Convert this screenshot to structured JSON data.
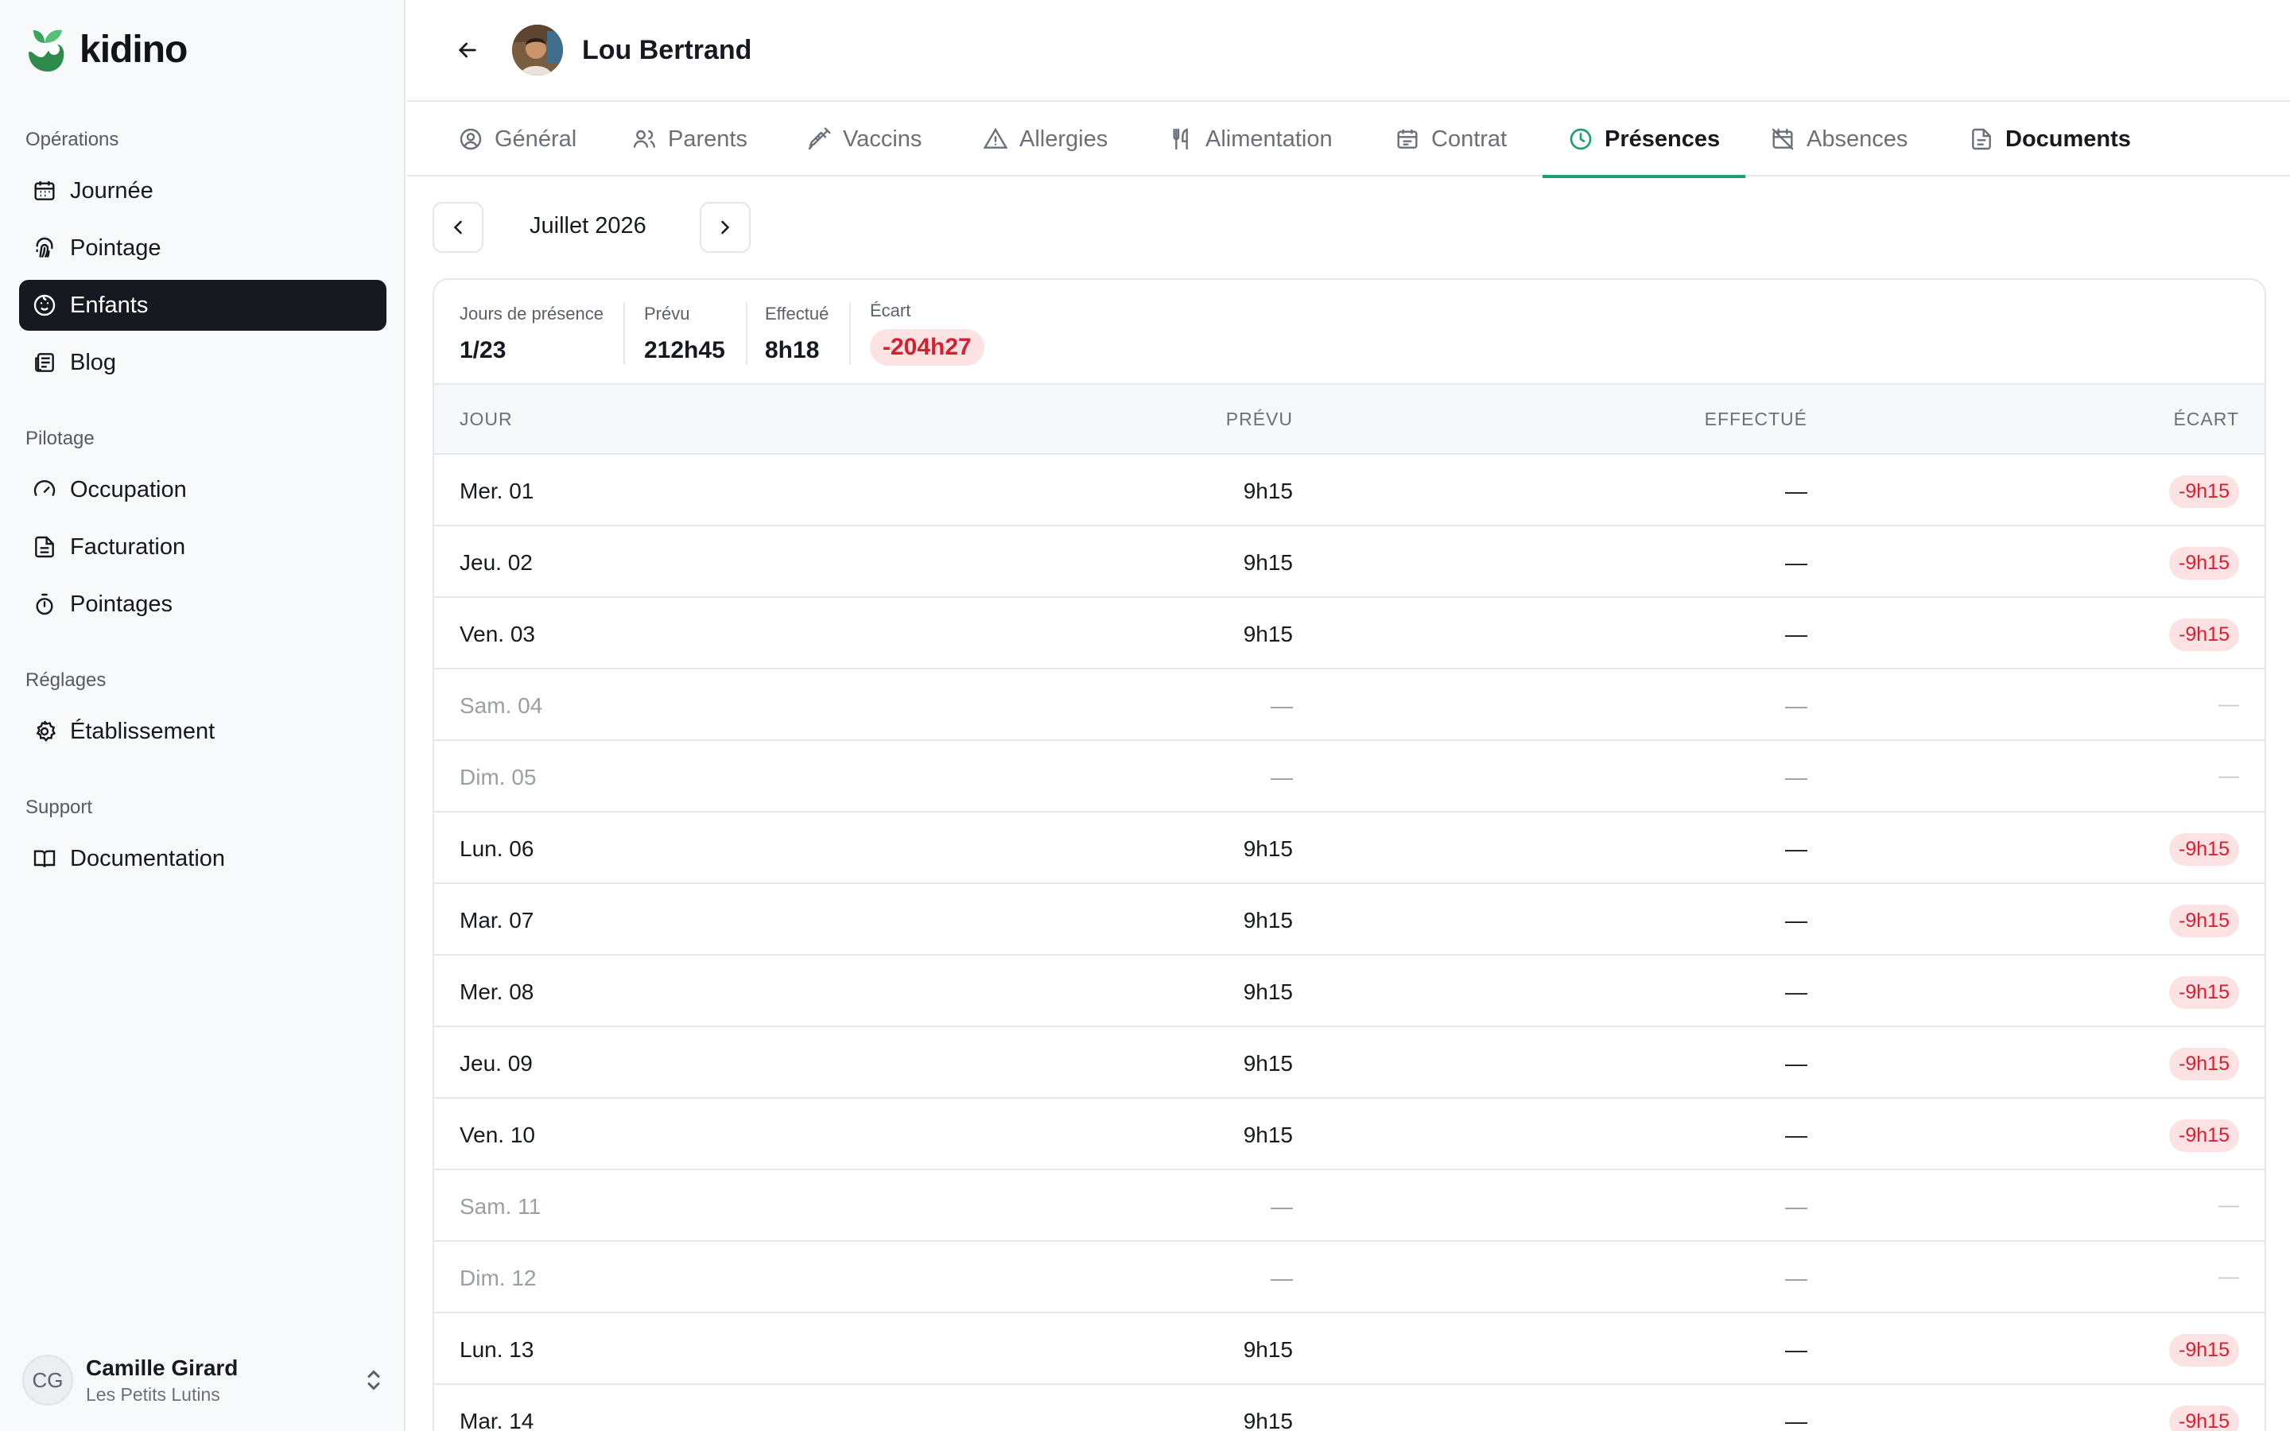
{
  "app": {
    "name": "kidino"
  },
  "sidebar": {
    "sections": [
      {
        "label": "Opérations"
      },
      {
        "label": "Pilotage"
      },
      {
        "label": "Réglages"
      },
      {
        "label": "Support"
      }
    ],
    "items": [
      {
        "label": "Journée",
        "icon": "calendar-icon"
      },
      {
        "label": "Pointage",
        "icon": "fingerprint-icon"
      },
      {
        "label": "Enfants",
        "icon": "baby-icon",
        "active": true
      },
      {
        "label": "Blog",
        "icon": "newspaper-icon"
      },
      {
        "label": "Occupation",
        "icon": "gauge-icon"
      },
      {
        "label": "Facturation",
        "icon": "file-text-icon"
      },
      {
        "label": "Pointages",
        "icon": "timer-icon"
      },
      {
        "label": "Établissement",
        "icon": "gear-icon"
      },
      {
        "label": "Documentation",
        "icon": "book-icon"
      }
    ],
    "user": {
      "initials": "CG",
      "name": "Camille Girard",
      "org": "Les Petits Lutins"
    }
  },
  "header": {
    "child_name": "Lou Bertrand"
  },
  "tabs": [
    {
      "label": "Général",
      "icon": "user-circle-icon"
    },
    {
      "label": "Parents",
      "icon": "users-icon"
    },
    {
      "label": "Vaccins",
      "icon": "syringe-icon"
    },
    {
      "label": "Allergies",
      "icon": "warning-icon"
    },
    {
      "label": "Alimentation",
      "icon": "utensils-icon"
    },
    {
      "label": "Contrat",
      "icon": "calendar-icon"
    },
    {
      "label": "Présences",
      "icon": "clock-icon",
      "active": true
    },
    {
      "label": "Absences",
      "icon": "calendar-off-icon"
    },
    {
      "label": "Documents",
      "icon": "file-icon"
    }
  ],
  "month": {
    "label": "Juillet 2026"
  },
  "stats": {
    "days_label": "Jours de présence",
    "days_value": "1/23",
    "planned_label": "Prévu",
    "planned_value": "212h45",
    "done_label": "Effectué",
    "done_value": "8h18",
    "gap_label": "Écart",
    "gap_value": "-204h27"
  },
  "table": {
    "columns": {
      "day": "JOUR",
      "planned": "PRÉVU",
      "done": "EFFECTUÉ",
      "gap": "ÉCART"
    },
    "rows": [
      {
        "day": "Mer. 01",
        "planned": "9h15",
        "done": "—",
        "gap": "-9h15"
      },
      {
        "day": "Jeu. 02",
        "planned": "9h15",
        "done": "—",
        "gap": "-9h15"
      },
      {
        "day": "Ven. 03",
        "planned": "9h15",
        "done": "—",
        "gap": "-9h15"
      },
      {
        "day": "Sam. 04",
        "planned": "—",
        "done": "—",
        "gap": "—",
        "weekend": true
      },
      {
        "day": "Dim. 05",
        "planned": "—",
        "done": "—",
        "gap": "—",
        "weekend": true
      },
      {
        "day": "Lun. 06",
        "planned": "9h15",
        "done": "—",
        "gap": "-9h15"
      },
      {
        "day": "Mar. 07",
        "planned": "9h15",
        "done": "—",
        "gap": "-9h15"
      },
      {
        "day": "Mer. 08",
        "planned": "9h15",
        "done": "—",
        "gap": "-9h15"
      },
      {
        "day": "Jeu. 09",
        "planned": "9h15",
        "done": "—",
        "gap": "-9h15"
      },
      {
        "day": "Ven. 10",
        "planned": "9h15",
        "done": "—",
        "gap": "-9h15"
      },
      {
        "day": "Sam. 11",
        "planned": "—",
        "done": "—",
        "gap": "—",
        "weekend": true
      },
      {
        "day": "Dim. 12",
        "planned": "—",
        "done": "—",
        "gap": "—",
        "weekend": true
      },
      {
        "day": "Lun. 13",
        "planned": "9h15",
        "done": "—",
        "gap": "-9h15"
      },
      {
        "day": "Mar. 14",
        "planned": "9h15",
        "done": "—",
        "gap": "-9h15"
      }
    ]
  },
  "colors": {
    "accent": "#1f9e6e",
    "active_nav": "#16191f",
    "negative": "#d5212f",
    "negative_bg": "#fde2e4"
  }
}
